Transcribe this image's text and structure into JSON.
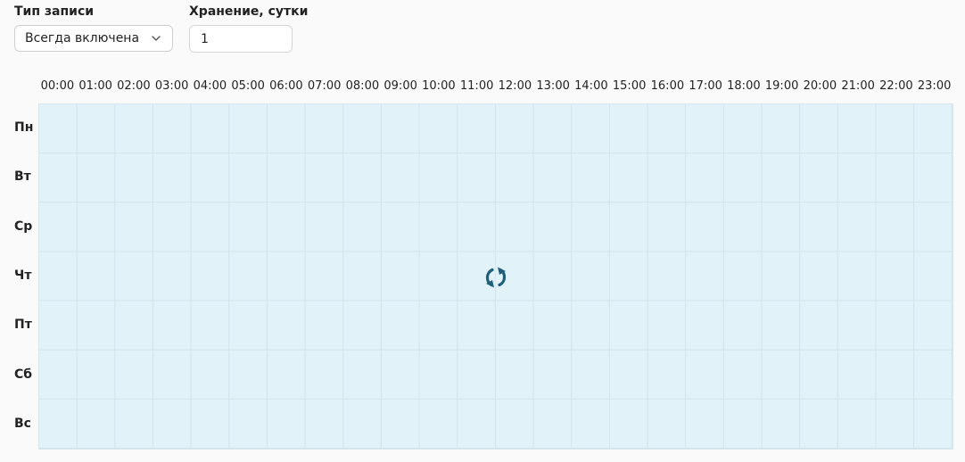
{
  "record_type": {
    "label": "Тип записи",
    "value": "Всегда включена"
  },
  "storage": {
    "label": "Хранение, сутки",
    "value": "1"
  },
  "schedule": {
    "hours": [
      "00:00",
      "01:00",
      "02:00",
      "03:00",
      "04:00",
      "05:00",
      "06:00",
      "07:00",
      "08:00",
      "09:00",
      "10:00",
      "11:00",
      "12:00",
      "13:00",
      "14:00",
      "15:00",
      "16:00",
      "17:00",
      "18:00",
      "19:00",
      "20:00",
      "21:00",
      "22:00",
      "23:00"
    ],
    "days": [
      "Пн",
      "Вт",
      "Ср",
      "Чт",
      "Пт",
      "Сб",
      "Вс"
    ]
  },
  "colors": {
    "grid_fill": "#e1f2f9",
    "spinner": "#1f5f7a"
  },
  "icons": {
    "dropdown": "chevron-down-icon",
    "loading": "refresh-icon"
  }
}
